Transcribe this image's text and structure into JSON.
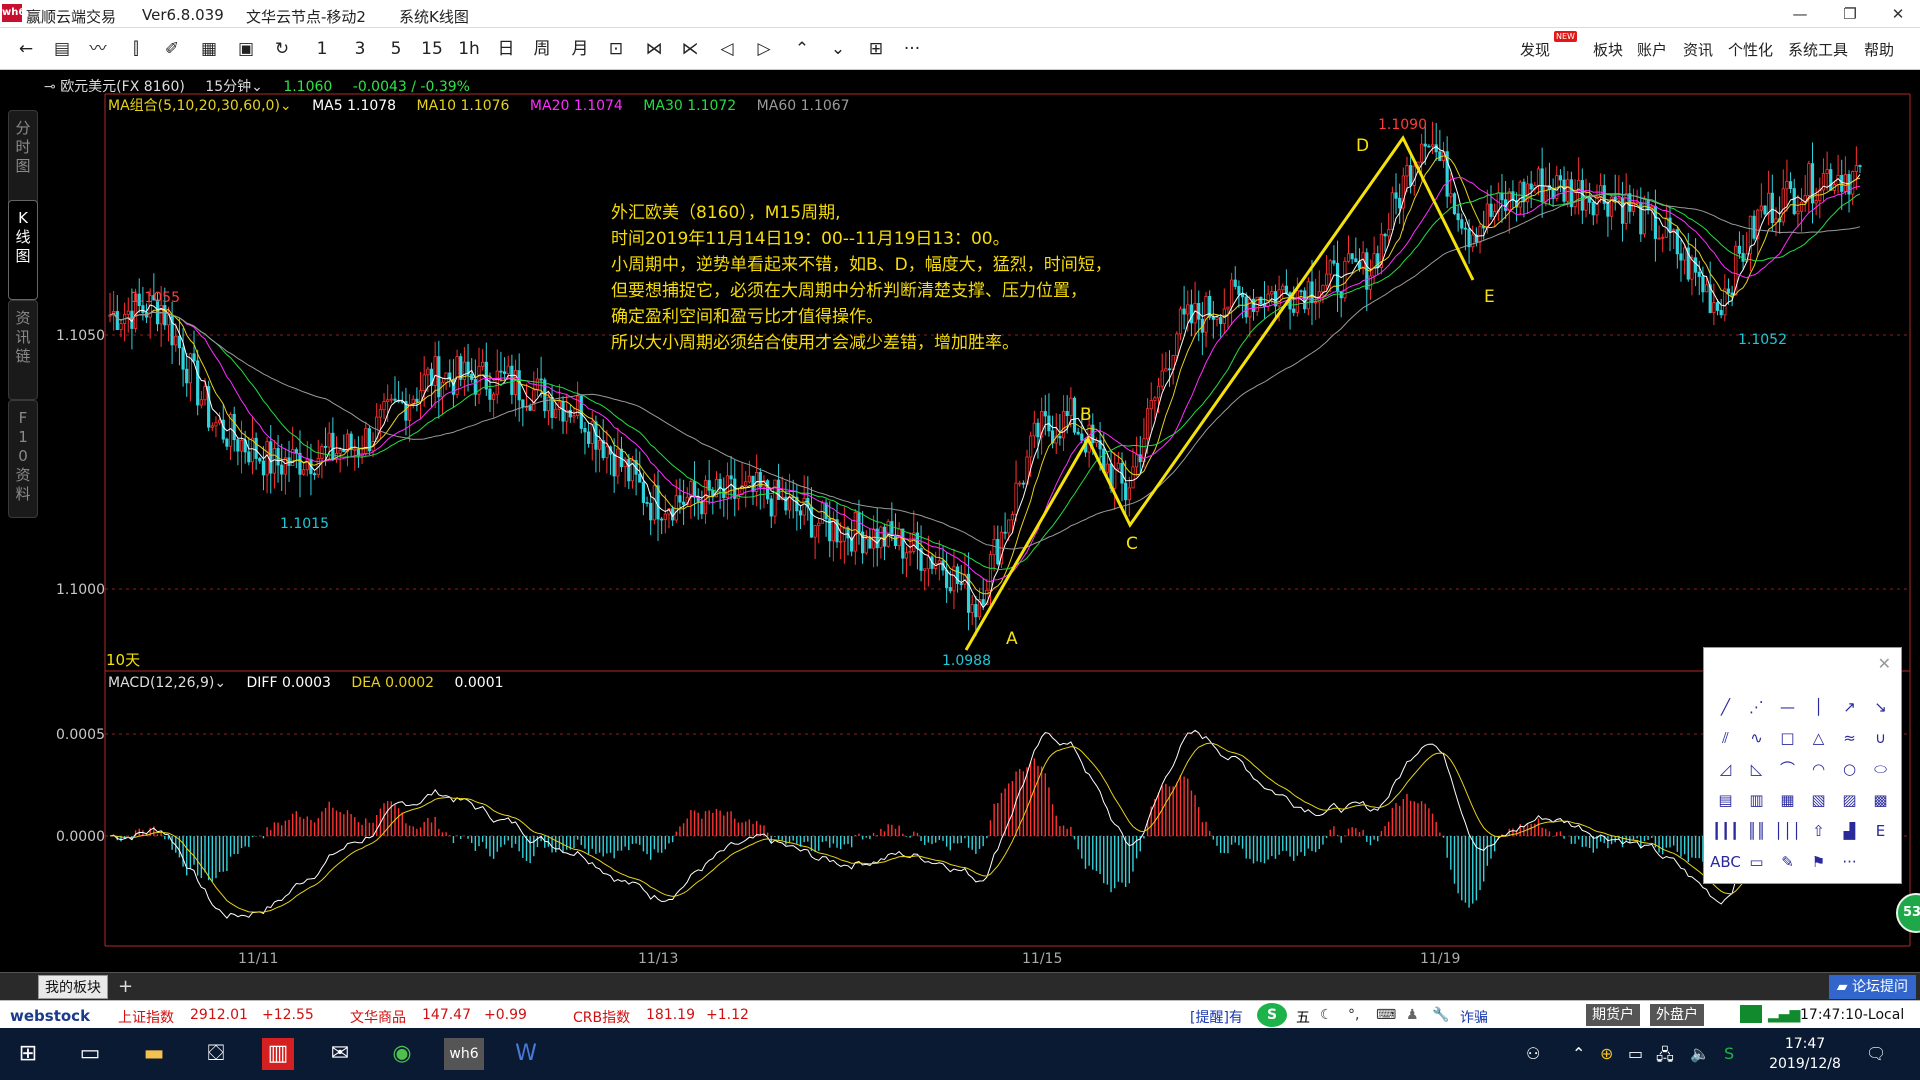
{
  "window": {
    "title": "赢顺云端交易",
    "version": "Ver6.8.039",
    "server": "文华云节点-移动2",
    "view": "系统K线图",
    "logo_text": "wh6",
    "controls": {
      "minimize": "—",
      "restore": "❐",
      "close": "✕"
    }
  },
  "toolbar": {
    "period_buttons": [
      "1",
      "3",
      "5",
      "15",
      "1h",
      "日",
      "周",
      "月"
    ],
    "menu": [
      "发现",
      "板块",
      "账户",
      "资讯",
      "个性化",
      "系统工具",
      "帮助"
    ],
    "new_badge": "NEW",
    "more": "···"
  },
  "side_tabs": [
    "分时图",
    "K线图",
    "资讯链",
    "F10资料"
  ],
  "instrument": {
    "name": "欧元美元(FX 8160)",
    "period": "15分钟",
    "price": "1.1060",
    "change": "-0.0043 / -0.39%"
  },
  "ma_line": {
    "label": "MA组合(5,10,20,30,60,0)",
    "ma5": "MA5 1.1078",
    "ma10": "MA10 1.1076",
    "ma20": "MA20 1.1074",
    "ma30": "MA30 1.1072",
    "ma60": "MA60 1.1067"
  },
  "macd_line": {
    "label": "MACD(12,26,9)",
    "diff": "DIFF 0.0003",
    "dea": "DEA 0.0002",
    "macd": "0.0001"
  },
  "annotation": [
    "外汇欧美（8160），M15周期,",
    "时间2019年11月14日19：00--11月19日13：00。",
    "小周期中，逆势单看起来不错，如B、D，幅度大，猛烈，时间短，",
    "但要想捕捉它，必须在大周期中分析判断清楚支撑、压力位置，",
    "确定盈利空间和盈亏比才值得操作。",
    "所以大小周期必须结合使用才会减少差错，增加胜率。"
  ],
  "price_axis": [
    "1.1050",
    "1.1000"
  ],
  "macd_axis": [
    "0.0005",
    "0.0000"
  ],
  "date_axis": [
    "11/11",
    "11/13",
    "11/15",
    "11/19"
  ],
  "price_marks": {
    "high_left": "1.1055",
    "low_left": "1.1015",
    "low_a": "1.0988",
    "high_d": "1.1090",
    "low_right": "1.1052"
  },
  "wave_labels": [
    "A",
    "B",
    "C",
    "D",
    "E"
  ],
  "range_label": "10天",
  "draw_tools": [
    "╱",
    "⋰",
    "—",
    "│",
    "↗",
    "↘",
    "⫽",
    "∿",
    "□",
    "△",
    "≈",
    "∪",
    "◿",
    "◺",
    "⌒",
    "◠",
    "○",
    "⬭",
    "▤",
    "▥",
    "▦",
    "▧",
    "▨",
    "▩",
    "┃┃┃",
    "║║",
    "│││",
    "⇧",
    "▟",
    "Ε",
    "ABC",
    "▭",
    "✎",
    "⚑",
    "···",
    ""
  ],
  "float_badge": "53",
  "tabs": {
    "my_board": "我的板块",
    "add": "+",
    "forum": "论坛提问"
  },
  "status": {
    "logo": "webstock",
    "sh_label": "上证指数",
    "sh_value": "2912.01",
    "sh_change": "+12.55",
    "wh_label": "文华商品",
    "wh_value": "147.47",
    "wh_change": "+0.99",
    "crb_label": "CRB指数",
    "crb_value": "181.19",
    "crb_change": "+1.12",
    "notice": "[提醒]有",
    "notice_tail": "诈骗",
    "ime": "五",
    "futures_btn": "期货户",
    "outer_btn": "外盘户",
    "time": "17:47:10-Local"
  },
  "taskbar": {
    "time": "17:47",
    "date": "2019/12/8"
  },
  "chart_data": {
    "type": "candlestick",
    "instrument": "欧元美元(FX 8160)",
    "period": "15分钟",
    "ylim": [
      1.0975,
      1.1095
    ],
    "x_ticks": [
      "11/11",
      "11/13",
      "11/15",
      "11/19"
    ],
    "y_ticks": [
      "1.1050",
      "1.1000"
    ],
    "waves": [
      {
        "label": "A",
        "value": 1.0988
      },
      {
        "label": "B",
        "value": 1.1028
      },
      {
        "label": "C",
        "value": 1.1012
      },
      {
        "label": "D",
        "value": 1.109
      },
      {
        "label": "E",
        "value": 1.1062
      }
    ],
    "marked_extremes": [
      1.1055,
      1.1015,
      1.0988,
      1.109,
      1.1052
    ],
    "ma_values": {
      "MA5": 1.1078,
      "MA10": 1.1076,
      "MA20": 1.1074,
      "MA30": 1.1072,
      "MA60": 1.1067
    },
    "macd": {
      "DIFF": 0.0003,
      "DEA": 0.0002,
      "MACD": 0.0001,
      "ylim": [
        -0.001,
        0.001
      ],
      "y_ticks": [
        "0.0005",
        "0.0000"
      ]
    },
    "path_anchors": [
      {
        "i": 0,
        "v": 1.105
      },
      {
        "i": 14,
        "v": 1.1052
      },
      {
        "i": 28,
        "v": 1.1027
      },
      {
        "i": 45,
        "v": 1.1018
      },
      {
        "i": 68,
        "v": 1.1022
      },
      {
        "i": 88,
        "v": 1.1037
      },
      {
        "i": 108,
        "v": 1.1036
      },
      {
        "i": 128,
        "v": 1.103
      },
      {
        "i": 148,
        "v": 1.101
      },
      {
        "i": 178,
        "v": 1.1012
      },
      {
        "i": 196,
        "v": 1.1005
      },
      {
        "i": 214,
        "v": 1.1002
      },
      {
        "i": 228,
        "v": 1.0997
      },
      {
        "i": 237,
        "v": 1.0988
      },
      {
        "i": 254,
        "v": 1.1025
      },
      {
        "i": 263,
        "v": 1.1028
      },
      {
        "i": 278,
        "v": 1.1012
      },
      {
        "i": 292,
        "v": 1.1047
      },
      {
        "i": 306,
        "v": 1.1053
      },
      {
        "i": 324,
        "v": 1.1055
      },
      {
        "i": 345,
        "v": 1.106
      },
      {
        "i": 360,
        "v": 1.109
      },
      {
        "i": 372,
        "v": 1.1068
      },
      {
        "i": 390,
        "v": 1.1078
      },
      {
        "i": 412,
        "v": 1.1075
      },
      {
        "i": 426,
        "v": 1.1067
      },
      {
        "i": 440,
        "v": 1.1052
      },
      {
        "i": 452,
        "v": 1.1072
      },
      {
        "i": 470,
        "v": 1.108
      }
    ]
  }
}
